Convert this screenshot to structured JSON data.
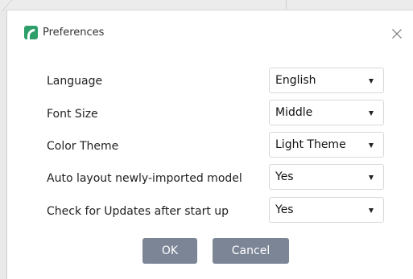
{
  "dialog": {
    "title": "Preferences",
    "icon": "app-logo-icon",
    "close_icon": "close-icon",
    "accent_color": "#2e9e6b"
  },
  "settings": [
    {
      "label": "Language",
      "value": "English"
    },
    {
      "label": "Font Size",
      "value": "Middle"
    },
    {
      "label": "Color Theme",
      "value": "Light Theme"
    },
    {
      "label": "Auto layout newly-imported model",
      "value": "Yes"
    },
    {
      "label": "Check for Updates after start up",
      "value": "Yes"
    }
  ],
  "buttons": {
    "ok_label": "OK",
    "cancel_label": "Cancel",
    "button_color": "#7c8596"
  }
}
